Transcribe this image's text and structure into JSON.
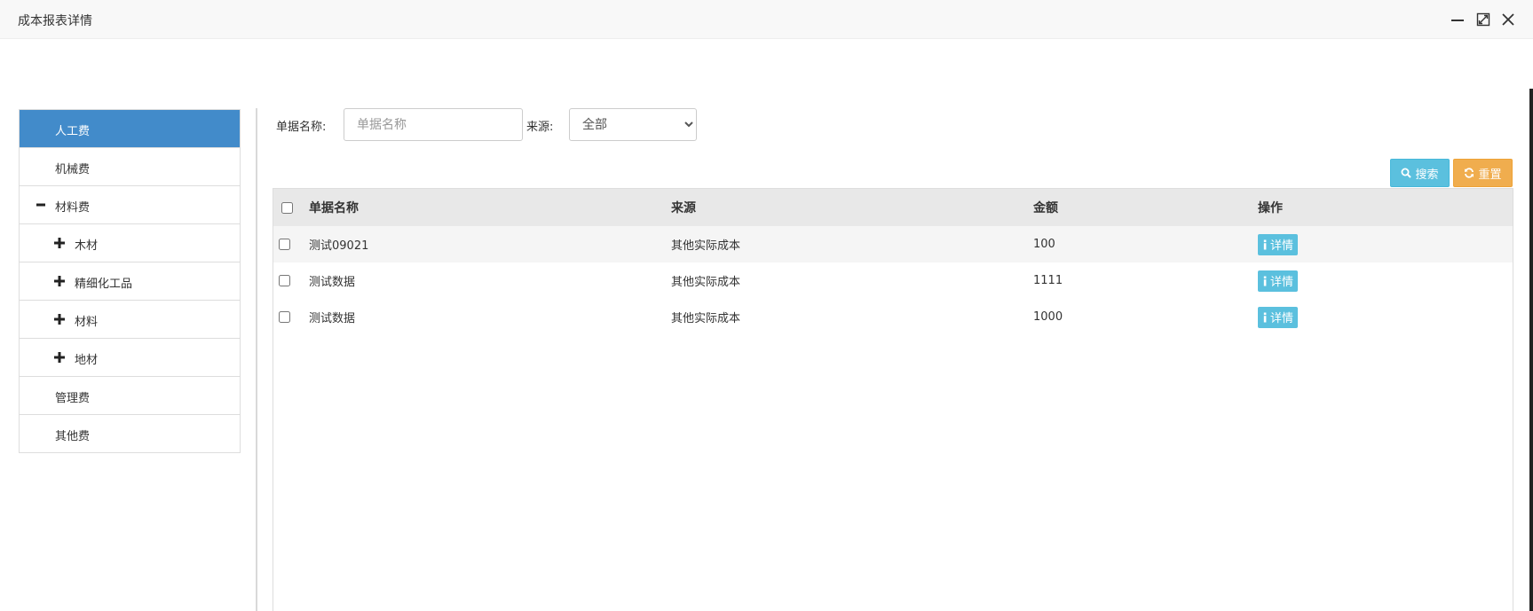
{
  "window": {
    "title": "成本报表详情"
  },
  "tree": {
    "items": [
      {
        "label": "人工费",
        "toggle": "",
        "active": true,
        "level": 0
      },
      {
        "label": "机械费",
        "toggle": "",
        "active": false,
        "level": 0
      },
      {
        "label": "材料费",
        "toggle": "minus",
        "active": false,
        "level": 0
      },
      {
        "label": "木材",
        "toggle": "plus",
        "active": false,
        "level": 1
      },
      {
        "label": "精细化工品",
        "toggle": "plus",
        "active": false,
        "level": 1
      },
      {
        "label": "材料",
        "toggle": "plus",
        "active": false,
        "level": 1
      },
      {
        "label": "地材",
        "toggle": "plus",
        "active": false,
        "level": 1
      },
      {
        "label": "管理费",
        "toggle": "",
        "active": false,
        "level": 0
      },
      {
        "label": "其他费",
        "toggle": "",
        "active": false,
        "level": 0
      }
    ]
  },
  "filter": {
    "name_label": "单据名称:",
    "name_placeholder": "单据名称",
    "name_value": "",
    "source_label": "来源:",
    "source_selected": "全部"
  },
  "buttons": {
    "search": "搜索",
    "reset": "重置"
  },
  "table": {
    "columns": [
      "单据名称",
      "来源",
      "金额",
      "操作"
    ],
    "rows": [
      {
        "name": "测试09021",
        "source": "其他实际成本",
        "amount": "100",
        "action": "详情"
      },
      {
        "name": "测试数据",
        "source": "其他实际成本",
        "amount": "1111",
        "action": "详情"
      },
      {
        "name": "测试数据",
        "source": "其他实际成本",
        "amount": "1000",
        "action": "详情"
      }
    ]
  },
  "colors": {
    "active": "#428bca",
    "info": "#5bc0de",
    "warning": "#f0ad4e"
  }
}
